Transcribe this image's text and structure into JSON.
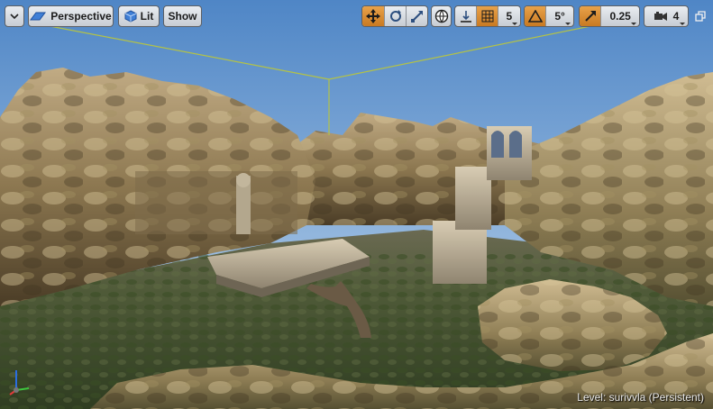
{
  "toolbar": {
    "view_mode": "Perspective",
    "lighting": "Lit",
    "show": "Show",
    "grid_snap_value": "5",
    "rotation_snap_value": "5°",
    "scale_snap_value": "0.25",
    "camera_speed": "4"
  },
  "status": {
    "level_label": "Level:  surivvla (Persistent)"
  },
  "icons": {
    "menu": "chevron-down-icon",
    "perspective": "perspective-cube-icon",
    "lit": "lit-sphere-cube-icon",
    "translate": "translate-arrows-icon",
    "rotate": "rotate-icon",
    "scale": "scale-icon",
    "world_local": "globe-icon",
    "surface_snap": "surface-snap-icon",
    "grid_snap": "grid-icon",
    "rotation_snap": "angle-icon",
    "scale_snap": "scale-arrow-icon",
    "camera_speed": "camera-icon",
    "maximize": "maximize-icon"
  },
  "colors": {
    "active_toggle": "#d8902f",
    "sky_top": "#4f86c6",
    "selection_outline": "#b3c247"
  }
}
